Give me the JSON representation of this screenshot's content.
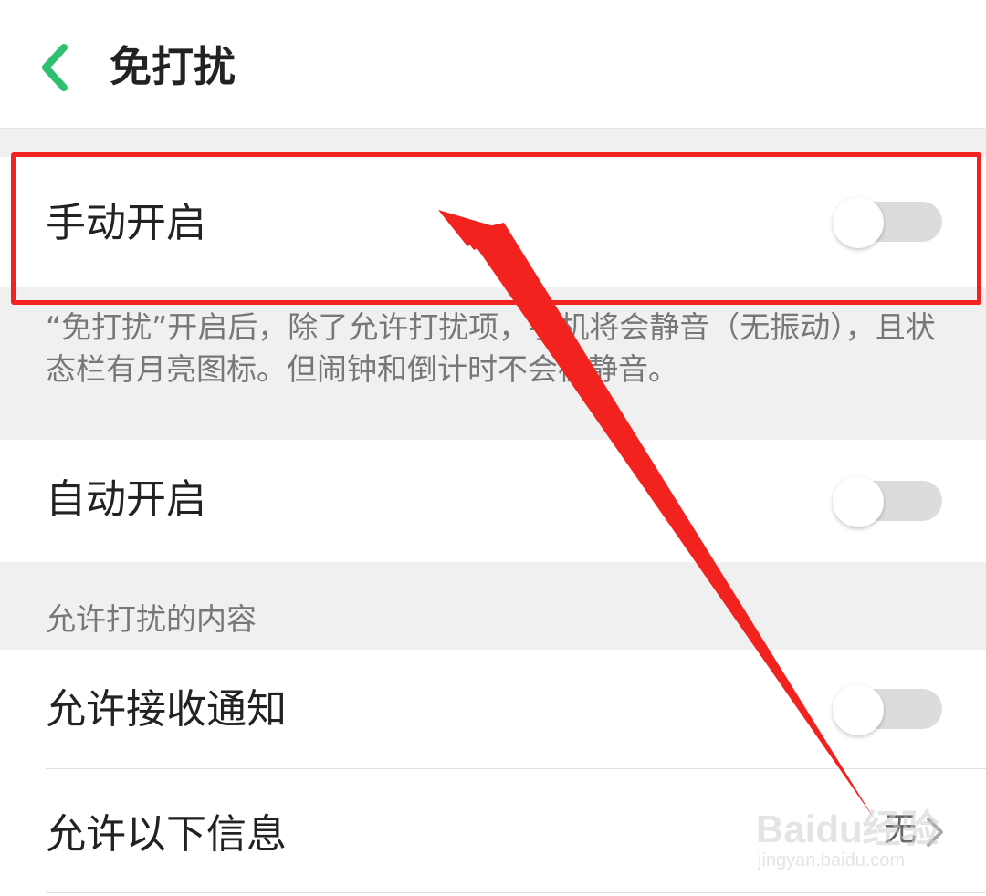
{
  "header": {
    "back_icon": "chevron-left-icon",
    "title": "免打扰"
  },
  "manual_on": {
    "label": "手动开启",
    "enabled": false
  },
  "description": "“免打扰”开启后，除了允许打扰项，手机将会静音（无振动），且状态栏有月亮图标。但闹钟和倒计时不会被静音。",
  "auto_on": {
    "label": "自动开启",
    "enabled": false
  },
  "allowed_section": {
    "header": "允许打扰的内容",
    "items": [
      {
        "label": "允许接收通知",
        "type": "toggle",
        "enabled": false
      },
      {
        "label": "允许以下信息",
        "type": "link",
        "value": "无"
      }
    ]
  },
  "annotation": {
    "box_color": "#f2231f",
    "arrow_color": "#f2231f"
  },
  "watermark": {
    "text": "Baidu经验",
    "url": "jingyan.baidu.com"
  },
  "colors": {
    "accent": "#2fbf71",
    "toggle_off_track": "#dcdcdc",
    "background": "#f0f0f0"
  }
}
